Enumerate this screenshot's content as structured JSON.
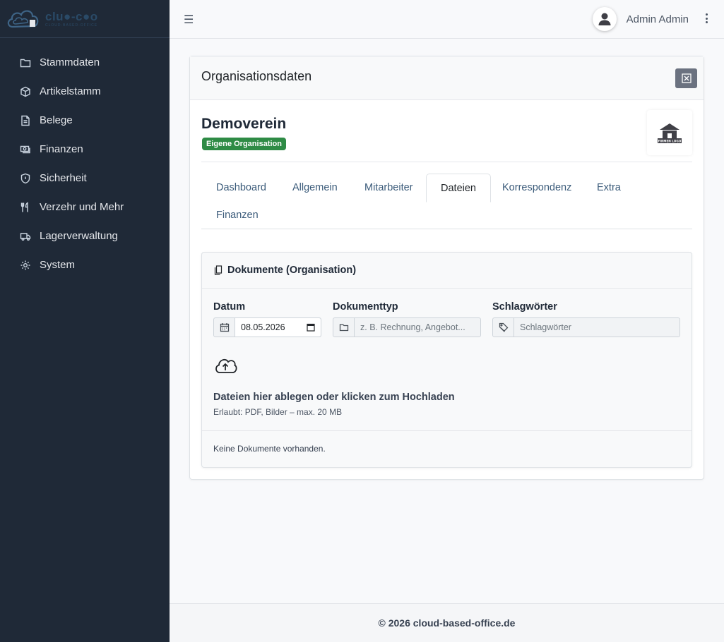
{
  "brand": {
    "name": "clu●-c●o",
    "sub": "CLOUD-BASED-OFFICE"
  },
  "sidebar": {
    "items": [
      {
        "label": "Stammdaten",
        "icon": "folder-icon"
      },
      {
        "label": "Artikelstamm",
        "icon": "box-icon"
      },
      {
        "label": "Belege",
        "icon": "document-icon"
      },
      {
        "label": "Finanzen",
        "icon": "cash-icon"
      },
      {
        "label": "Sicherheit",
        "icon": "shield-icon"
      },
      {
        "label": "Verzehr und Mehr",
        "icon": "cutlery-icon"
      },
      {
        "label": "Lagerverwaltung",
        "icon": "truck-icon"
      },
      {
        "label": "System",
        "icon": "gear-icon"
      }
    ]
  },
  "topbar": {
    "menu_glyph": "☰",
    "user_name": "Admin Admin"
  },
  "card": {
    "title": "Organisationsdaten",
    "org_name": "Demoverein",
    "badge": "Eigene Organisation",
    "logo_text": "FIRMEN LOGO"
  },
  "tabs": [
    {
      "label": "Dashboard",
      "active": false
    },
    {
      "label": "Allgemein",
      "active": false
    },
    {
      "label": "Mitarbeiter",
      "active": false
    },
    {
      "label": "Dateien",
      "active": true
    },
    {
      "label": "Korrespondenz",
      "active": false
    },
    {
      "label": "Extra",
      "active": false
    },
    {
      "label": "Finanzen",
      "active": false
    }
  ],
  "documents": {
    "title": "Dokumente (Organisation)",
    "date_label": "Datum",
    "date_value": "08.05.2026",
    "type_label": "Dokumenttyp",
    "type_placeholder": "z. B. Rechnung, Angebot...",
    "tags_label": "Schlagwörter",
    "tags_placeholder": "Schlagwörter",
    "drop_title": "Dateien hier ablegen oder klicken zum Hochladen",
    "drop_sub": "Erlaubt: PDF, Bilder – max. 20 MB",
    "empty": "Keine Dokumente vorhanden."
  },
  "footer": {
    "text": "© 2026 cloud-based-office.de"
  },
  "colors": {
    "sidebar_bg": "#1f2937",
    "badge_bg": "#2e8b45",
    "tab_link": "#3b5b7a"
  }
}
